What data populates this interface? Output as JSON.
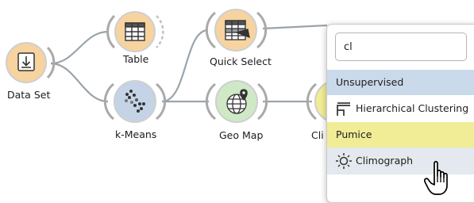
{
  "canvas": {
    "nodes": [
      {
        "id": "data-set",
        "label": "Data Set",
        "icon": "file-import-icon"
      },
      {
        "id": "table",
        "label": "Table",
        "icon": "table-icon"
      },
      {
        "id": "k-means",
        "label": "k-Means",
        "icon": "kmeans-icon"
      },
      {
        "id": "quick-select",
        "label": "Quick Select",
        "icon": "quick-select-icon"
      },
      {
        "id": "geo-map",
        "label": "Geo Map",
        "icon": "globe-pin-icon"
      },
      {
        "id": "climograph",
        "label": "Cli",
        "icon": "climograph-icon"
      }
    ]
  },
  "popup": {
    "search_value": "cl",
    "categories": [
      {
        "name": "Unsupervised",
        "color": "#cbdaea",
        "items": [
          {
            "label": "Hierarchical Clustering",
            "icon": "dendrogram-icon"
          }
        ]
      },
      {
        "name": "Pumice",
        "color": "#f1ec96",
        "items": [
          {
            "label": "Climograph",
            "icon": "sun-icon"
          }
        ]
      }
    ]
  },
  "colors": {
    "node_fill": "#f6d39f",
    "node_outline": "#8f8f8f",
    "link": "#9aa4ab",
    "selected_item_bg": "#e3e9ee"
  }
}
